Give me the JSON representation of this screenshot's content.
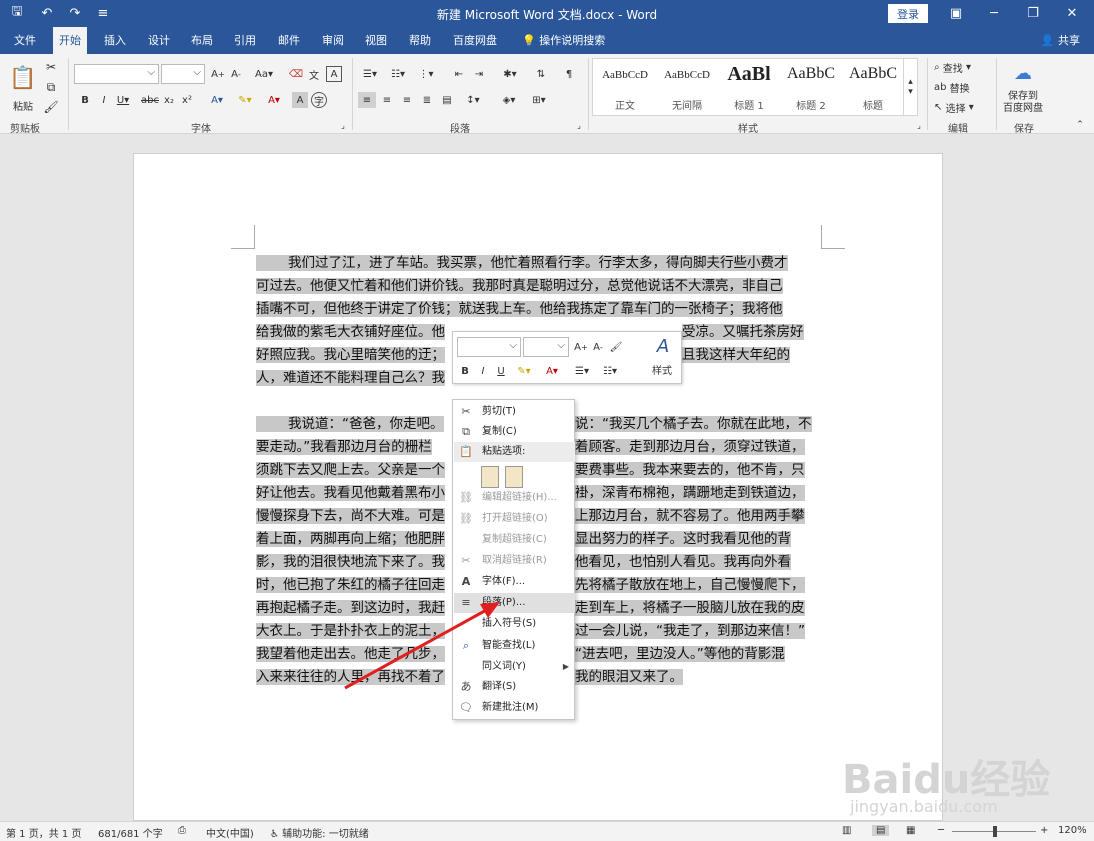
{
  "titlebar": {
    "title": "新建 Microsoft Word 文档.docx - Word",
    "login": "登录"
  },
  "tabs": [
    {
      "label": "文件"
    },
    {
      "label": "开始"
    },
    {
      "label": "插入"
    },
    {
      "label": "设计"
    },
    {
      "label": "布局"
    },
    {
      "label": "引用"
    },
    {
      "label": "邮件"
    },
    {
      "label": "审阅"
    },
    {
      "label": "视图"
    },
    {
      "label": "帮助"
    },
    {
      "label": "百度网盘"
    },
    {
      "label": "操作说明搜索"
    }
  ],
  "share": "共享",
  "ribbon": {
    "groups": {
      "clipboard": "剪贴板",
      "font": "字体",
      "paragraph": "段落",
      "styles": "样式",
      "editing": "编辑",
      "save": "保存"
    },
    "paste": "粘贴",
    "styles": [
      {
        "sample": "AaBbCcD",
        "name": "正文"
      },
      {
        "sample": "AaBbCcD",
        "name": "无间隔"
      },
      {
        "sample": "AaBl",
        "name": "标题 1"
      },
      {
        "sample": "AaBbC",
        "name": "标题 2"
      },
      {
        "sample": "AaBbC",
        "name": "标题"
      }
    ],
    "find": "查找",
    "replace": "替换",
    "select": "选择",
    "save_baidu": "保存到",
    "save_baidu2": "百度网盘"
  },
  "document": {
    "para1": [
      "我们过了江，进了车站。我买票，他忙着照看行李。行李太多，得向脚夫行些小费才",
      "可过去。他便又忙着和他们讲价钱。我那时真是聪明过分，总觉他说话不大漂亮，非自己",
      "插嘴不可，但他终于讲定了价钱；就送我上车。他给我拣定了靠车门的一张椅子；我将他",
      "给我做的紫毛大衣铺好座位。他",
      "好照应我。我心里暗笑他的迂；",
      "人，难道还不能料理自己么？我"
    ],
    "para1_right": [
      "受凉。又嘱托茶房好",
      "且我这样大年纪的"
    ],
    "para2": [
      "我说道：“爸爸，你走吧。",
      "要走动。”我看那边月台的栅栏",
      "须跳下去又爬上去。父亲是一个",
      "好让他去。我看见他戴着黑布小",
      "慢慢探身下去，尚不大难。可是",
      "着上面，两脚再向上缩；他肥胖",
      "影，我的泪很快地流下来了。我",
      "时，他已抱了朱红的橘子往回走",
      "再抱起橘子走。到这边时，我赶",
      "大衣上。于是扑扑衣上的泥土，",
      "我望着他走出去。他走了几步，",
      "入来来往往的人里，再找不着了"
    ],
    "para2_right": [
      "说：“我买几个橘子去。你就在此地，不",
      "着顾客。走到那边月台，须穿过铁道，",
      "要费事些。我本来要去的，他不肯，只",
      "褂，深青布棉袍，蹒跚地走到铁道边，",
      "上那边月台，就不容易了。他用两手攀",
      "显出努力的样子。这时我看见他的背",
      "他看见，也怕别人看见。我再向外看",
      "先将橘子散放在地上，自己慢慢爬下，",
      "走到车上，将橘子一股脑儿放在我的皮",
      "过一会儿说，“我走了，到那边来信！”",
      "“进去吧，里边没人。”等他的背影混",
      "我的眼泪又来了。"
    ]
  },
  "mini_toolbar": {
    "bold": "B",
    "italic": "I",
    "underline": "U",
    "font_color": "A",
    "styles": "样式"
  },
  "context_menu": {
    "items": [
      {
        "label": "剪切(T)",
        "icon": "scissors-icon",
        "enabled": true
      },
      {
        "label": "复制(C)",
        "icon": "copy-icon",
        "enabled": true
      },
      {
        "label": "粘贴选项:",
        "icon": "paste-icon",
        "enabled": true
      },
      {
        "label": "编辑超链接(H)...",
        "icon": "link-icon",
        "enabled": false
      },
      {
        "label": "打开超链接(O)",
        "icon": "link-icon",
        "enabled": false
      },
      {
        "label": "复制超链接(C)",
        "icon": "",
        "enabled": false
      },
      {
        "label": "取消超链接(R)",
        "icon": "unlink-icon",
        "enabled": false
      },
      {
        "label": "字体(F)...",
        "icon": "font-icon",
        "enabled": true
      },
      {
        "label": "段落(P)...",
        "icon": "paragraph-icon",
        "enabled": true
      },
      {
        "label": "插入符号(S)",
        "icon": "",
        "enabled": true
      },
      {
        "label": "智能查找(L)",
        "icon": "search-icon",
        "enabled": true
      },
      {
        "label": "同义词(Y)",
        "icon": "",
        "enabled": true
      },
      {
        "label": "翻译(S)",
        "icon": "translate-icon",
        "enabled": true
      },
      {
        "label": "新建批注(M)",
        "icon": "comment-icon",
        "enabled": true
      }
    ]
  },
  "statusbar": {
    "page": "第 1 页，共 1 页",
    "words": "681/681 个字",
    "lang": "中文(中国)",
    "accessibility": "辅助功能: 一切就绪",
    "zoom": "120%"
  },
  "watermark": {
    "main": "Baidu经验",
    "sub": "jingyan.baidu.com"
  }
}
